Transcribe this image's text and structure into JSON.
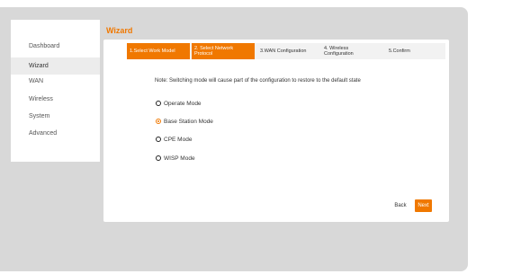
{
  "colors": {
    "accent": "#f07800",
    "frame": "#d8d8d8",
    "panel": "#ffffff"
  },
  "sidebar": {
    "items": [
      {
        "label": "Dashboard",
        "active": false
      },
      {
        "label": "Wizard",
        "active": true
      },
      {
        "label": "WAN",
        "active": false
      },
      {
        "label": "Wireless",
        "active": false
      },
      {
        "label": "System",
        "active": false
      },
      {
        "label": "Advanced",
        "active": false
      }
    ]
  },
  "wizard": {
    "title": "Wizard",
    "steps": [
      {
        "label": "1.Select Work Model",
        "done": true
      },
      {
        "label": "2. Select Network Protocol",
        "done": true
      },
      {
        "label": "3.WAN Configuration",
        "done": false
      },
      {
        "label": "4. Wireless Configuration",
        "done": false
      },
      {
        "label": "5.Confirm",
        "done": false
      }
    ],
    "note": "Note: Switching mode will cause part of the configuration to restore to the default state",
    "modes": [
      {
        "label": "Operate Mode",
        "checked": false
      },
      {
        "label": "Base Station Mode",
        "checked": true
      },
      {
        "label": "CPE Mode",
        "checked": false
      },
      {
        "label": "WISP Mode",
        "checked": false
      }
    ],
    "back_label": "Back",
    "next_label": "Next"
  }
}
